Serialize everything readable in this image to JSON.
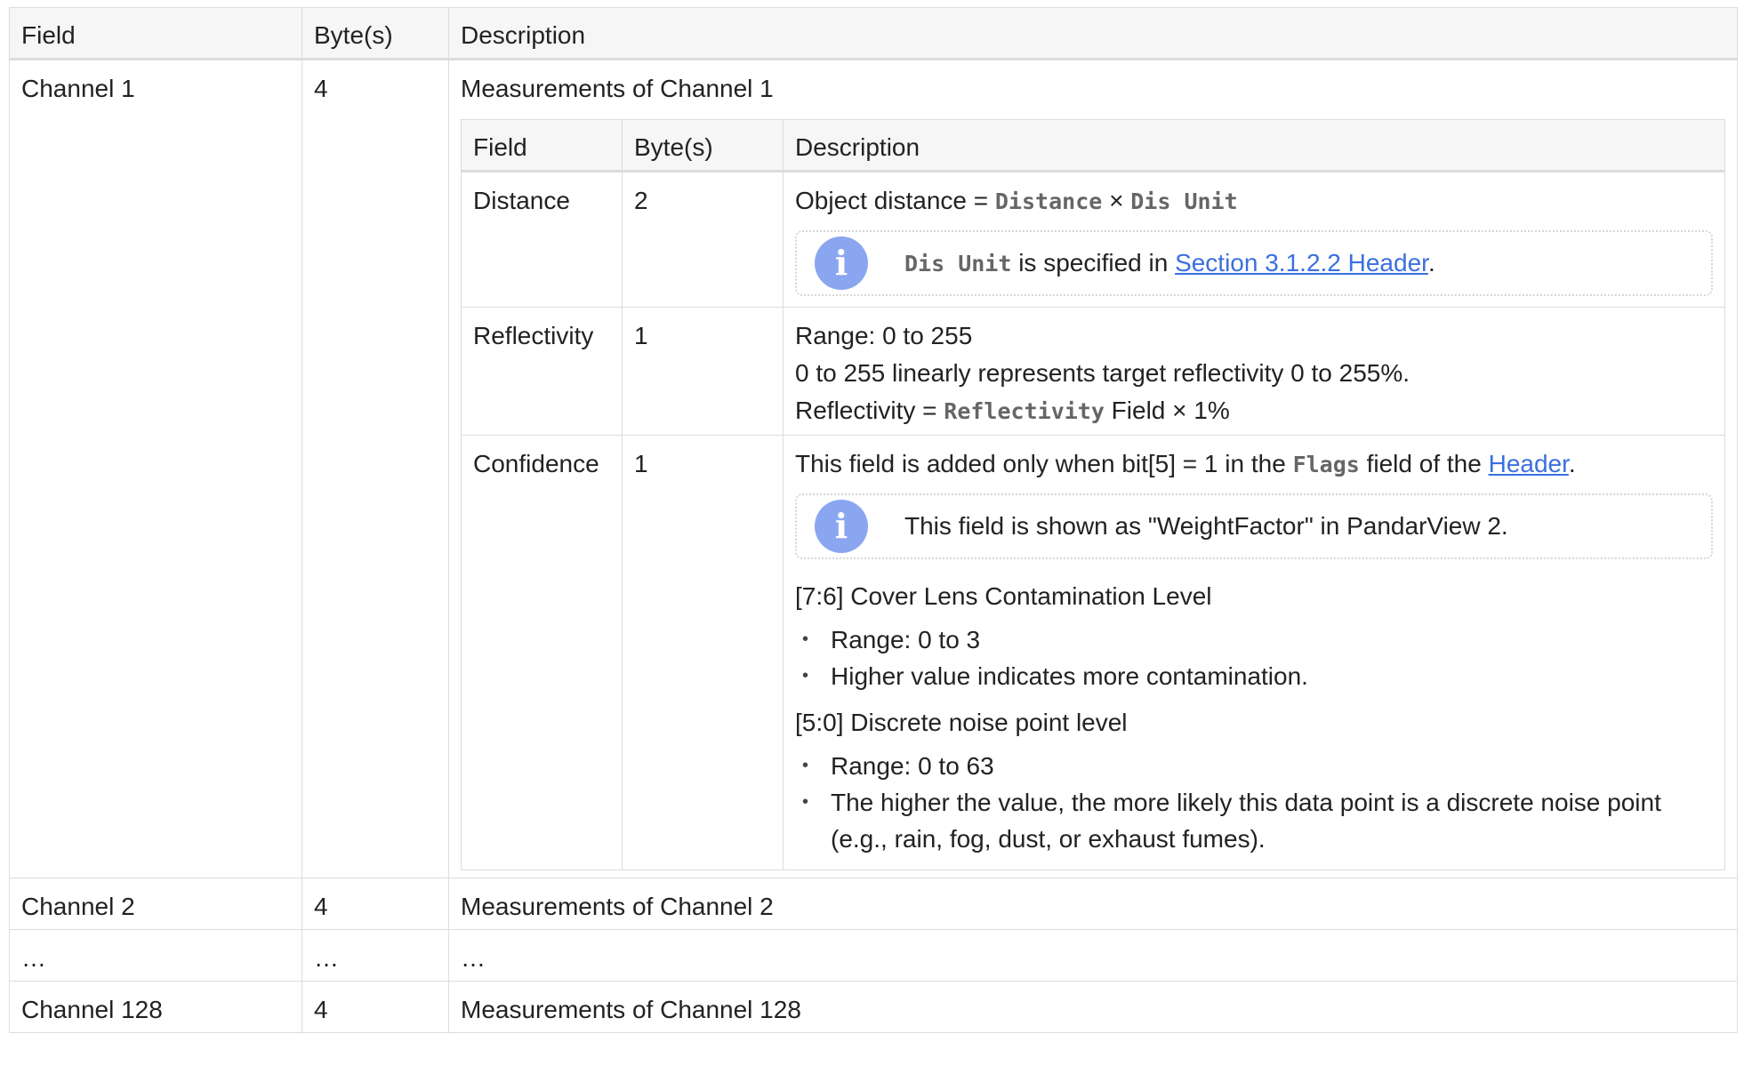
{
  "headers": {
    "field": "Field",
    "bytes": "Byte(s)",
    "description": "Description"
  },
  "rows": [
    {
      "field": "Channel 1",
      "bytes": "4",
      "description": "Measurements of Channel 1"
    },
    {
      "field": "Channel 2",
      "bytes": "4",
      "description": "Measurements of Channel 2"
    },
    {
      "field": "…",
      "bytes": "…",
      "description": "…"
    },
    {
      "field": "Channel 128",
      "bytes": "4",
      "description": "Measurements of Channel 128"
    }
  ],
  "inner": {
    "headers": {
      "field": "Field",
      "bytes": "Byte(s)",
      "description": "Description"
    },
    "distance": {
      "field": "Distance",
      "bytes": "2",
      "formula_prefix": "Object distance = ",
      "code1": "Distance",
      "times": " × ",
      "code2": "Dis Unit",
      "note_code": "Dis Unit",
      "note_text": " is specified in ",
      "note_link": "Section 3.1.2.2 Header",
      "note_end": "."
    },
    "reflectivity": {
      "field": "Reflectivity",
      "bytes": "1",
      "line1": "Range: 0 to 255",
      "line2": "0 to 255 linearly represents target reflectivity 0 to 255%.",
      "line3_prefix": "Reflectivity = ",
      "line3_code": "Reflectivity",
      "line3_suffix": " Field × 1%"
    },
    "confidence": {
      "field": "Confidence",
      "bytes": "1",
      "intro_prefix": "This field is added only when bit[5] = 1 in the ",
      "intro_code": "Flags",
      "intro_mid": " field of the ",
      "intro_link": "Header",
      "intro_end": ".",
      "note": "This field is shown as \"WeightFactor\" in PandarView 2.",
      "sub1_title": "[7:6] Cover Lens Contamination Level",
      "sub1_items": [
        "Range: 0 to 3",
        "Higher value indicates more contamination."
      ],
      "sub2_title": "[5:0] Discrete noise point level",
      "sub2_items": [
        "Range: 0 to 63",
        "The higher the value, the more likely this data point is a discrete noise point (e.g., rain, fog, dust, or exhaust fumes)."
      ]
    }
  },
  "icons": {
    "note": "info-icon",
    "note_glyph": "i"
  },
  "colors": {
    "link": "#3b6fe0",
    "info_icon": "#8aa6f0",
    "header_bg": "#f6f6f6"
  }
}
